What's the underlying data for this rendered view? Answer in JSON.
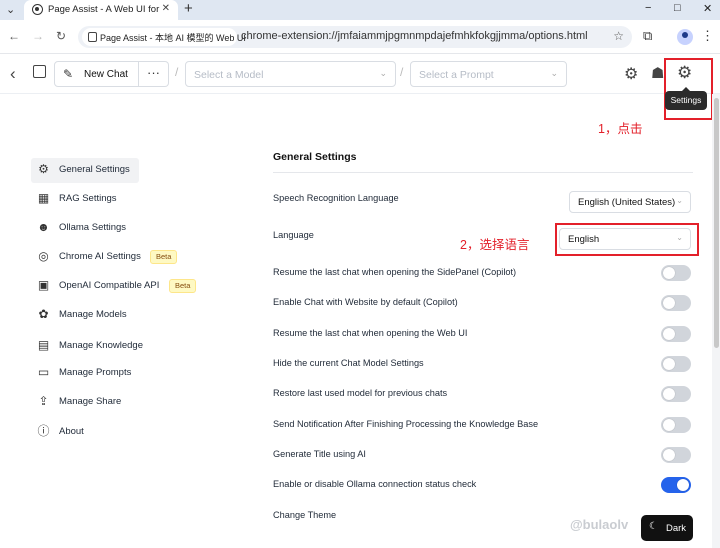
{
  "browser": {
    "tab_title": "Page Assist - A Web UI for Lo",
    "new_tab": "+",
    "site_chip": "Page Assist - 本地 AI 模型的 Web UI",
    "url": "chrome-extension://jmfaiammjpgmnmpdajefmhkfokgjjmma/options.html",
    "min": "−",
    "max": "□",
    "close": "✕"
  },
  "header": {
    "new_chat_label": "New Chat",
    "model_placeholder": "Select a Model",
    "prompt_placeholder": "Select a Prompt",
    "settings_tooltip": "Settings"
  },
  "annotations": {
    "step1": "1，点击",
    "step2": "2，选择语言",
    "color": "#e3202a"
  },
  "sidebar": {
    "items": [
      {
        "label": "General Settings",
        "icon": "gear-icon",
        "active": true
      },
      {
        "label": "RAG Settings",
        "icon": "rag-icon"
      },
      {
        "label": "Ollama Settings",
        "icon": "ollama-icon"
      },
      {
        "label": "Chrome AI Settings",
        "icon": "chrome-icon",
        "badge": "Beta"
      },
      {
        "label": "OpenAI Compatible API",
        "icon": "chip-icon",
        "badge": "Beta"
      },
      {
        "label": "Manage Models",
        "icon": "brain-icon"
      },
      {
        "label": "Manage Knowledge",
        "icon": "blocks-icon"
      },
      {
        "label": "Manage Prompts",
        "icon": "book-icon"
      },
      {
        "label": "Manage Share",
        "icon": "share-icon"
      },
      {
        "label": "About",
        "icon": "info-icon"
      }
    ]
  },
  "main": {
    "title": "General Settings",
    "speech_label": "Speech Recognition Language",
    "speech_value": "English (United States)",
    "language_label": "Language",
    "language_value": "English",
    "toggles": [
      {
        "label": "Resume the last chat when opening the SidePanel (Copilot)",
        "on": false
      },
      {
        "label": "Enable Chat with Website by default (Copilot)",
        "on": false
      },
      {
        "label": "Resume the last chat when opening the Web UI",
        "on": false
      },
      {
        "label": "Hide the current Chat Model Settings",
        "on": false
      },
      {
        "label": "Restore last used model for previous chats",
        "on": false
      },
      {
        "label": "Send Notification After Finishing Processing the Knowledge Base",
        "on": false
      },
      {
        "label": "Generate Title using AI",
        "on": false
      },
      {
        "label": "Enable or disable Ollama connection status check",
        "on": true
      }
    ],
    "theme_label": "Change Theme",
    "theme_button": "Dark"
  },
  "watermark": "@bulaolv",
  "accent_color": "#2563eb"
}
